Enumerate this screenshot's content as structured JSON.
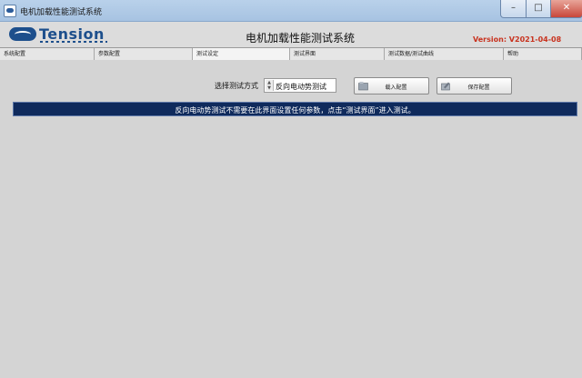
{
  "window": {
    "title": "电机加载性能测试系统"
  },
  "header": {
    "logo_text": "Tension",
    "system_title": "电机加载性能测试系统",
    "version": "Version: V2021-04-08"
  },
  "tabs": [
    {
      "label": "系统配置"
    },
    {
      "label": "参数配置"
    },
    {
      "label": "测试设定",
      "active": true
    },
    {
      "label": "测试界面"
    },
    {
      "label": "测试数据/测试曲线"
    },
    {
      "label": "帮助"
    }
  ],
  "test_setup": {
    "mode_label": "选择测试方式",
    "mode_value": "反向电动势测试",
    "load_button": "载入配置",
    "save_button": "保存配置"
  },
  "info_banner": "反向电动势测试不需要在此界面设置任何参数，点击“测试界面”进入测试。",
  "colors": {
    "banner_bg": "#0f2a5c",
    "version_text": "#c8321e",
    "logo": "#1d4f8c"
  }
}
